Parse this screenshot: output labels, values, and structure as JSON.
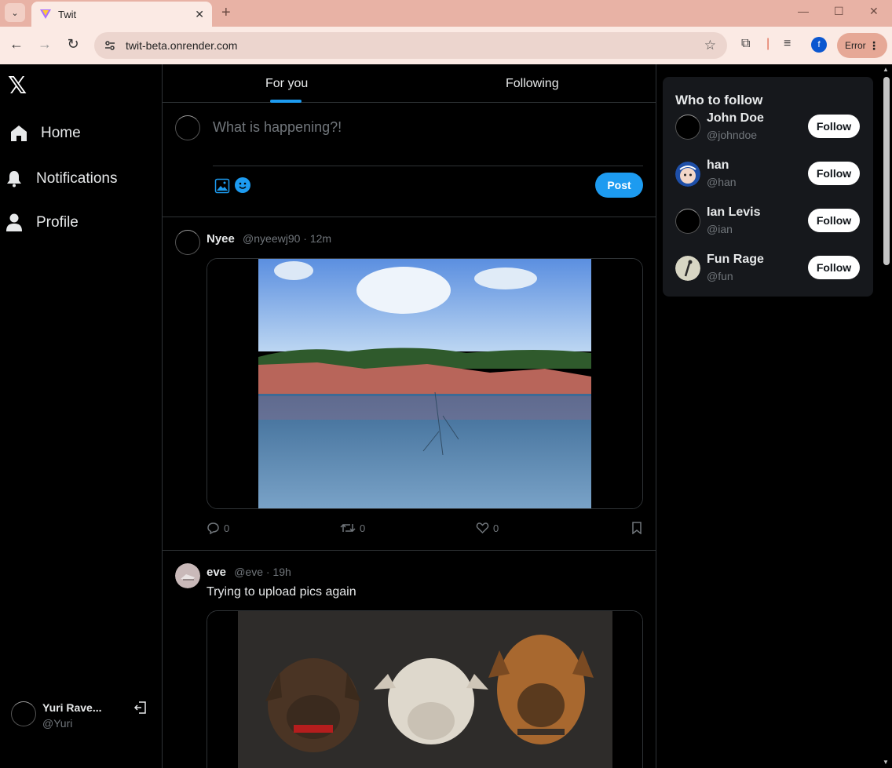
{
  "browser": {
    "tab_title": "Twit",
    "url": "twit-beta.onrender.com",
    "profile_initial": "f",
    "error_label": "Error"
  },
  "sidebar": {
    "logo": "𝕏",
    "items": [
      {
        "label": "Home",
        "icon": "home-icon"
      },
      {
        "label": "Notifications",
        "icon": "bell-icon"
      },
      {
        "label": "Profile",
        "icon": "user-icon"
      }
    ],
    "me": {
      "name": "Yuri Rave...",
      "handle": "@Yuri"
    }
  },
  "feed": {
    "tabs": [
      "For you",
      "Following"
    ],
    "active_tab": "For you",
    "composer_placeholder": "What is happening?!",
    "post_label": "Post"
  },
  "tweets": [
    {
      "name": "Nyee",
      "meta": "@nyeewj90 · 12m",
      "text": "",
      "replies": "0",
      "reposts": "0",
      "likes": "0"
    },
    {
      "name": "eve",
      "meta": "@eve · 19h",
      "text": "Trying to upload pics again"
    }
  ],
  "who_to_follow": {
    "title": "Who to follow",
    "follow_label": "Follow",
    "users": [
      {
        "name": "John Doe",
        "handle": "@johndoe"
      },
      {
        "name": "han",
        "handle": "@han"
      },
      {
        "name": "Ian Levis",
        "handle": "@ian"
      },
      {
        "name": "Fun Rage",
        "handle": "@fun"
      }
    ]
  },
  "colors": {
    "accent": "#1d9bf0",
    "background": "#000000",
    "chrome": "#fbeae4"
  }
}
